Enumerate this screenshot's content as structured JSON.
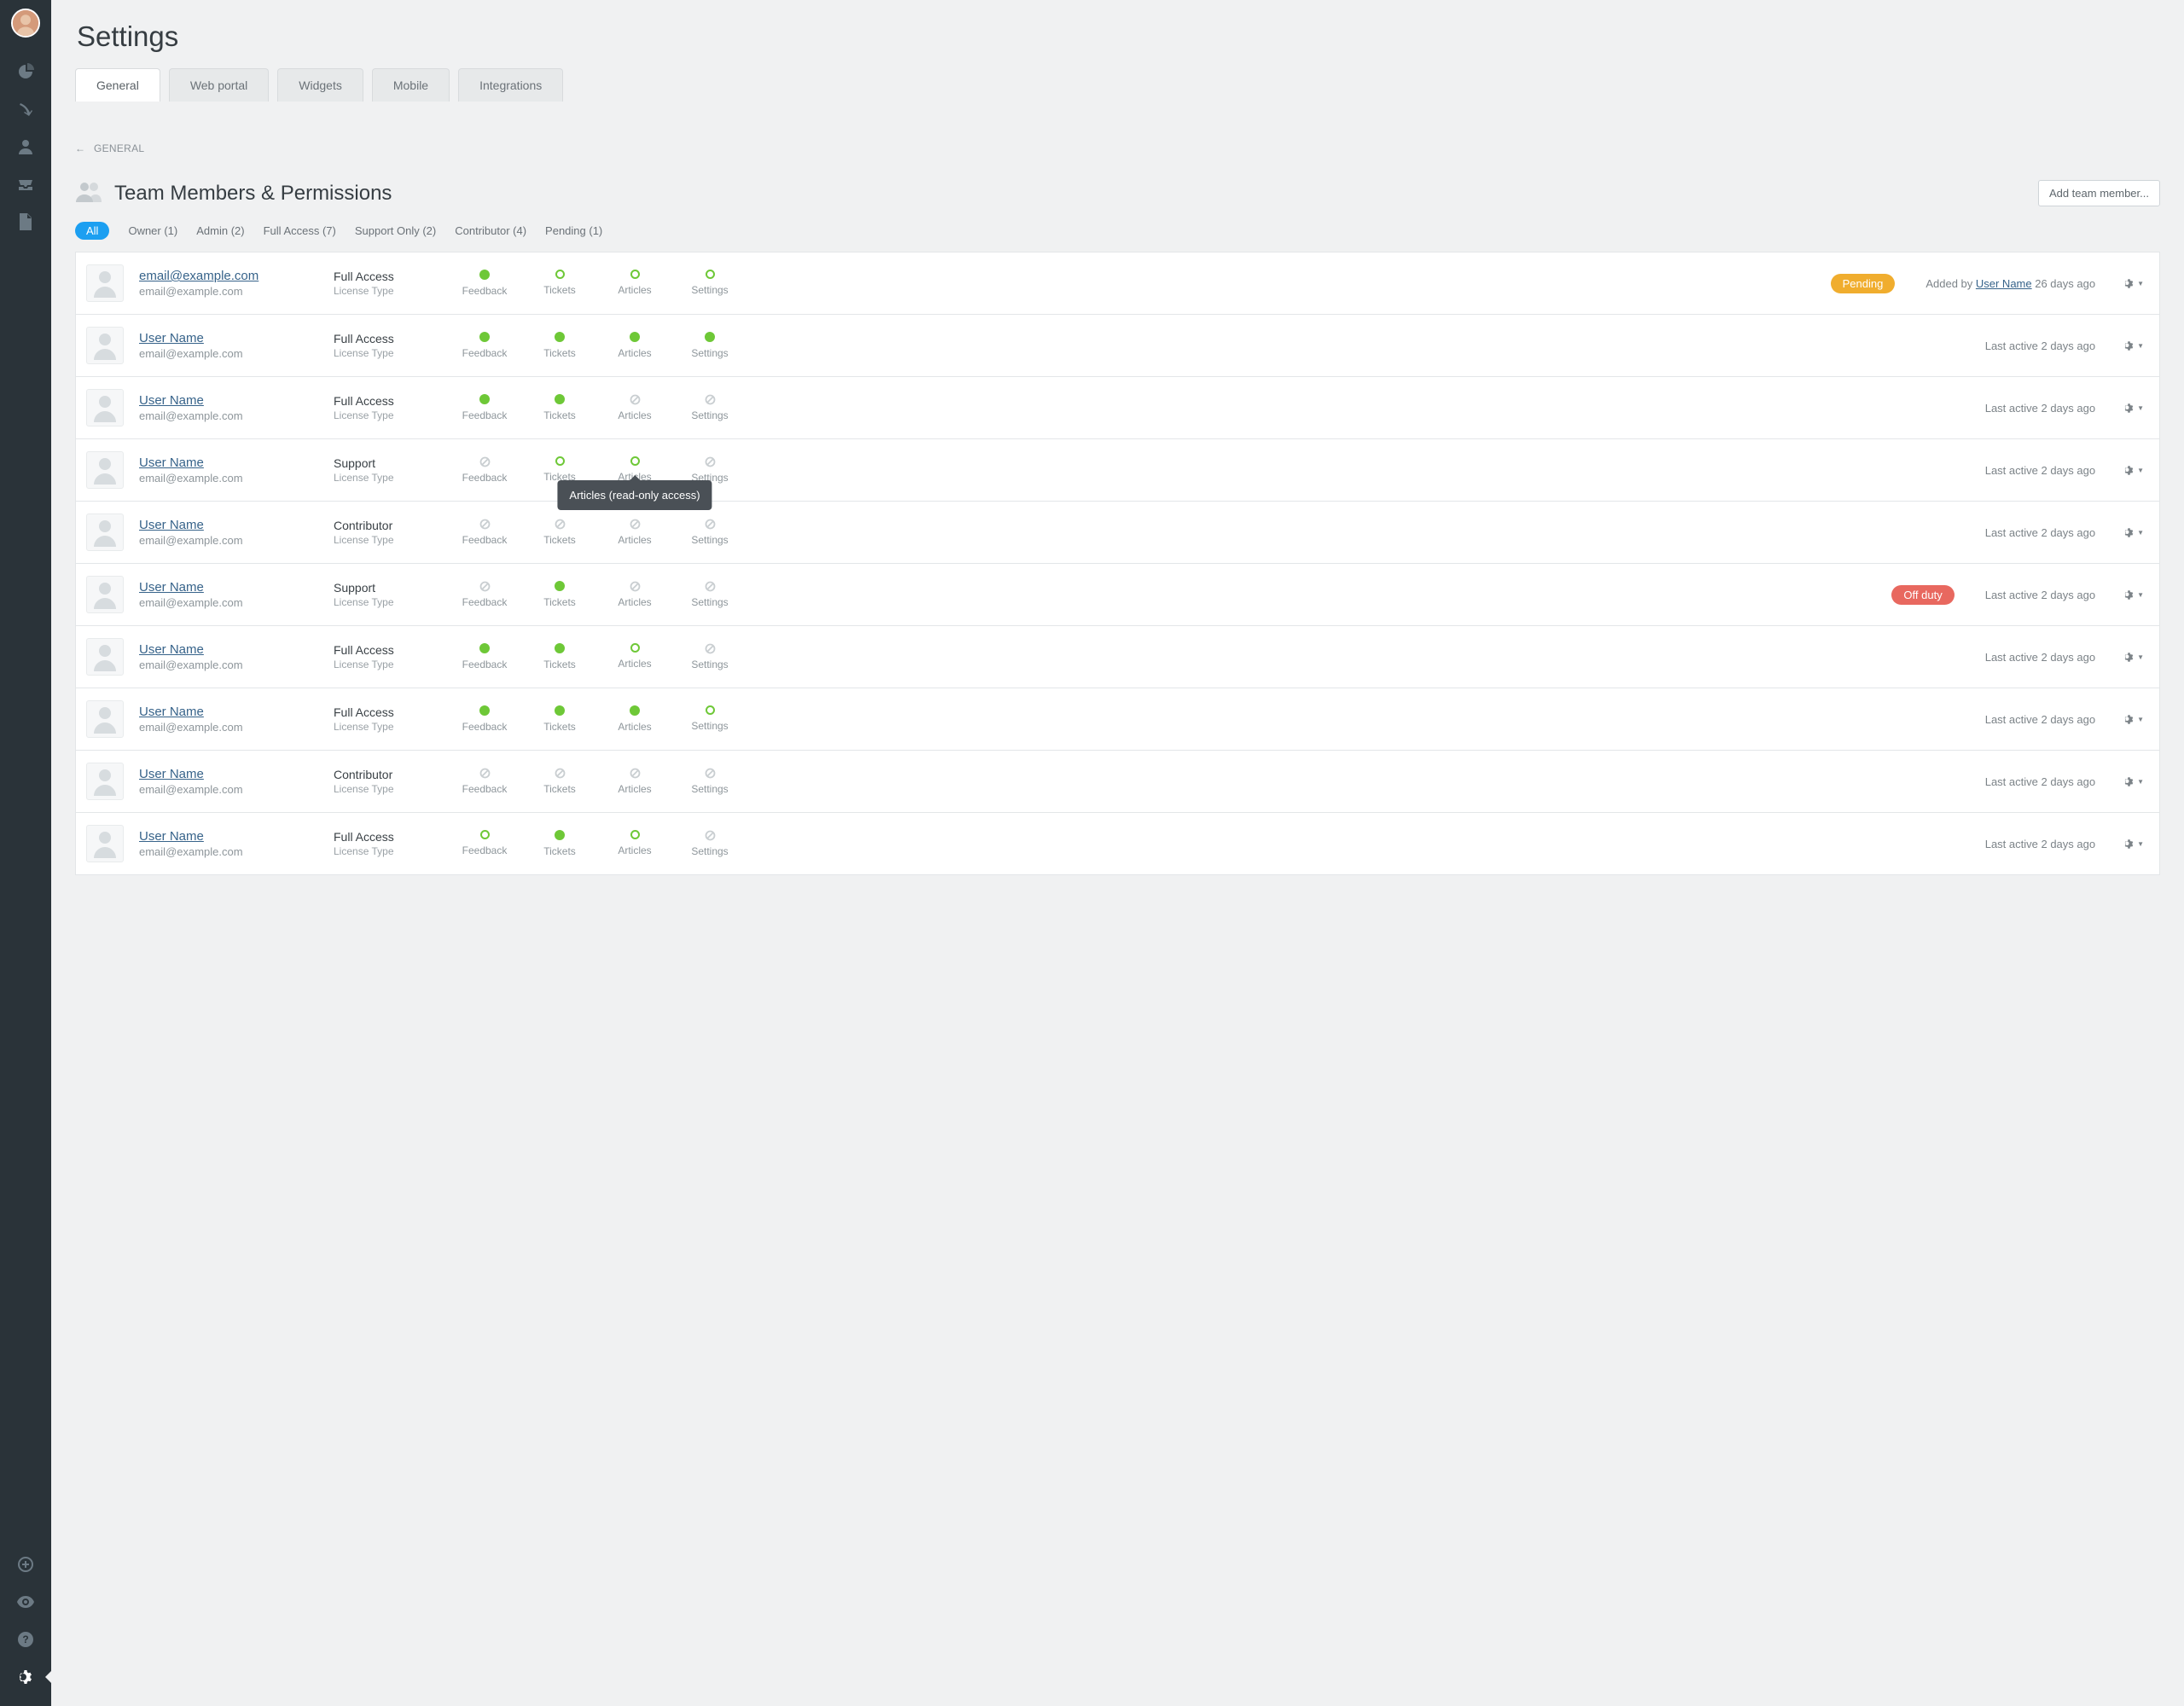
{
  "page": {
    "title": "Settings"
  },
  "tabs": [
    "General",
    "Web portal",
    "Widgets",
    "Mobile",
    "Integrations"
  ],
  "active_tab": 0,
  "breadcrumb": {
    "arrow": "←",
    "label": "GENERAL"
  },
  "section": {
    "title": "Team Members & Permissions",
    "add_label": "Add team member..."
  },
  "filters": {
    "all": "All",
    "items": [
      "Owner (1)",
      "Admin (2)",
      "Full Access (7)",
      "Support Only (2)",
      "Contributor (4)",
      "Pending (1)"
    ]
  },
  "perm_cols": [
    "Feedback",
    "Tickets",
    "Articles",
    "Settings"
  ],
  "tooltip": {
    "text": "Articles (read-only access)",
    "row": 3,
    "col": 2
  },
  "rows": [
    {
      "name": "email@example.com",
      "email": "email@example.com",
      "role": "Full Access",
      "license": "License Type",
      "perms": [
        "full",
        "ro",
        "ro",
        "ro"
      ],
      "badge": {
        "kind": "pending",
        "text": "Pending"
      },
      "meta_prefix": "Added by ",
      "meta_link": "User Name",
      "meta_suffix": " 26 days ago"
    },
    {
      "name": "User Name",
      "email": "email@example.com",
      "role": "Full Access",
      "license": "License Type",
      "perms": [
        "full",
        "full",
        "full",
        "full"
      ],
      "meta_plain": "Last active 2 days ago"
    },
    {
      "name": "User Name",
      "email": "email@example.com",
      "role": "Full Access",
      "license": "License Type",
      "perms": [
        "full",
        "full",
        "none",
        "none"
      ],
      "meta_plain": "Last active 2 days ago"
    },
    {
      "name": "User Name",
      "email": "email@example.com",
      "role": "Support",
      "license": "License Type",
      "perms": [
        "none",
        "ro",
        "ro",
        "none"
      ],
      "meta_plain": "Last active 2 days ago"
    },
    {
      "name": "User Name",
      "email": "email@example.com",
      "role": "Contributor",
      "license": "License Type",
      "perms": [
        "none",
        "none",
        "none",
        "none"
      ],
      "meta_plain": "Last active 2 days ago"
    },
    {
      "name": "User Name",
      "email": "email@example.com",
      "role": "Support",
      "license": "License Type",
      "perms": [
        "none",
        "full",
        "none",
        "none"
      ],
      "badge": {
        "kind": "offduty",
        "text": "Off duty"
      },
      "meta_plain": "Last active 2 days ago"
    },
    {
      "name": "User Name",
      "email": "email@example.com",
      "role": "Full Access",
      "license": "License Type",
      "perms": [
        "full",
        "full",
        "ro",
        "none"
      ],
      "meta_plain": "Last active 2 days ago"
    },
    {
      "name": "User Name",
      "email": "email@example.com",
      "role": "Full Access",
      "license": "License Type",
      "perms": [
        "full",
        "full",
        "full",
        "ro"
      ],
      "meta_plain": "Last active 2 days ago"
    },
    {
      "name": "User Name",
      "email": "email@example.com",
      "role": "Contributor",
      "license": "License Type",
      "perms": [
        "none",
        "none",
        "none",
        "none"
      ],
      "meta_plain": "Last active 2 days ago"
    },
    {
      "name": "User Name",
      "email": "email@example.com",
      "role": "Full Access",
      "license": "License Type",
      "perms": [
        "ro",
        "full",
        "ro",
        "none"
      ],
      "meta_plain": "Last active 2 days ago"
    }
  ]
}
